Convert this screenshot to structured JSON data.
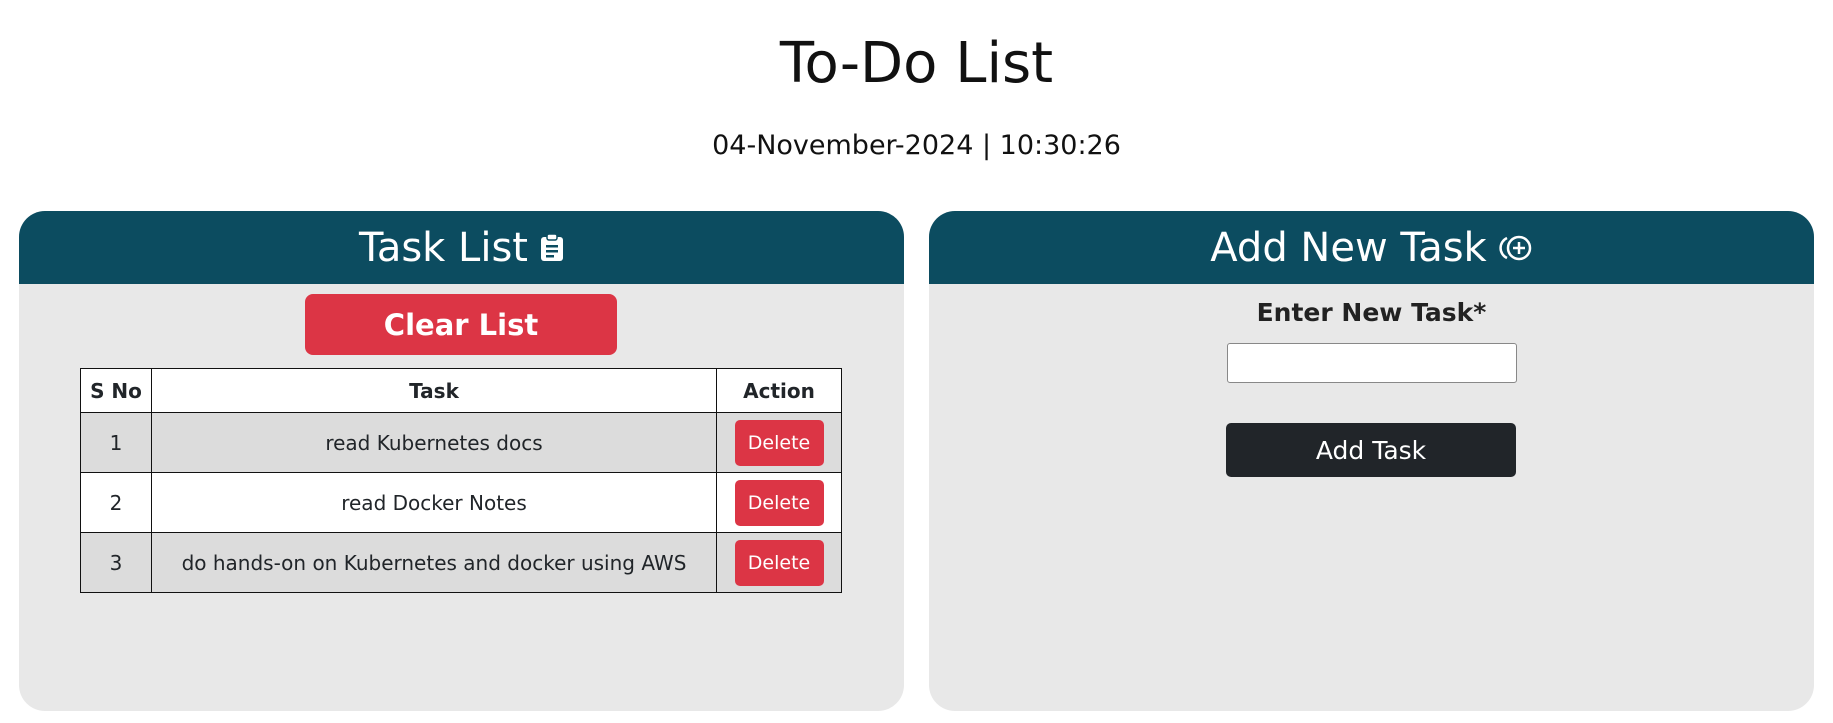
{
  "page": {
    "title": "To-Do List",
    "datetime": "04-November-2024 | 10:30:26"
  },
  "task_list_panel": {
    "title": "Task List",
    "icon": "clipboard-icon",
    "clear_button_label": "Clear List",
    "columns": [
      "S No",
      "Task",
      "Action"
    ],
    "rows": [
      {
        "sno": "1",
        "task": "read Kubernetes docs",
        "action": "Delete"
      },
      {
        "sno": "2",
        "task": "read Docker Notes",
        "action": "Delete"
      },
      {
        "sno": "3",
        "task": "do hands-on on Kubernetes and docker using AWS",
        "action": "Delete"
      }
    ]
  },
  "add_task_panel": {
    "title": "Add New Task",
    "icon": "add-circle-icon",
    "field_label": "Enter New Task*",
    "input_value": "",
    "button_label": "Add Task"
  },
  "colors": {
    "header_bg": "#0c4c60",
    "panel_bg": "#e8e8e8",
    "danger": "#dc3545",
    "dark_button": "#212529"
  }
}
